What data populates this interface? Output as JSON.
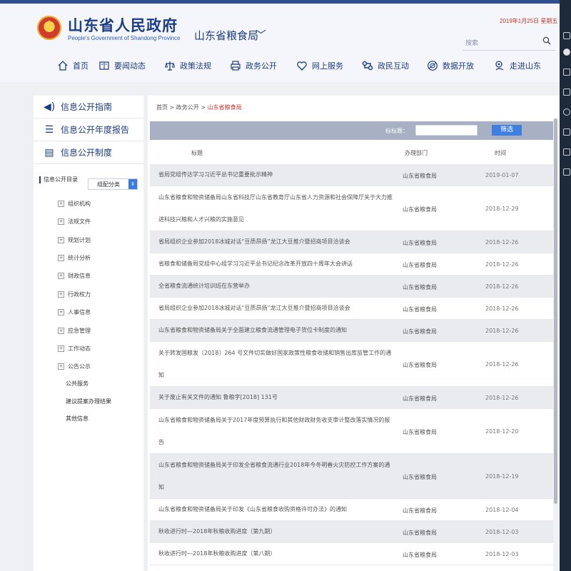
{
  "header": {
    "site_title": "山东省人民政府",
    "site_subtitle": "People's Government of Shandong Province",
    "dept_title": "山东省粮食局",
    "date_text": "2019年1月25日 星期五",
    "search_label": "搜索"
  },
  "nav": [
    {
      "label": "首页",
      "icon": "home-icon"
    },
    {
      "label": "要闻动态",
      "icon": "news-icon"
    },
    {
      "label": "政策法规",
      "icon": "scale-icon"
    },
    {
      "label": "政务公开",
      "icon": "printer-icon"
    },
    {
      "label": "网上服务",
      "icon": "heart-icon"
    },
    {
      "label": "政民互动",
      "icon": "link-icon"
    },
    {
      "label": "数据开放",
      "icon": "dataset-icon"
    },
    {
      "label": "走进山东",
      "icon": "location-icon"
    }
  ],
  "sidebar": {
    "guides": [
      {
        "label": "信息公开指南",
        "icon": "speaker-icon"
      },
      {
        "label": "信息公开年度报告",
        "icon": "list-icon"
      },
      {
        "label": "信息公开制度",
        "icon": "print-icon"
      }
    ],
    "catalog_title": "信息公开目录",
    "catalog_select": "组配分类",
    "tree": [
      "组织机构",
      "法规文件",
      "规划计划",
      "统计分析",
      "财政信息",
      "行政权力",
      "人事信息",
      "应急管理",
      "工作动态",
      "公告公示"
    ],
    "leaves": [
      "公共服务",
      "建议提案办理结果",
      "其他信息"
    ]
  },
  "main": {
    "breadcrumb_prefix": "首页 > 政务公开 > ",
    "breadcrumb_current": "山东省粮食局",
    "filter_label": "标标题：",
    "filter_button": "筛选",
    "columns": {
      "title": "标题",
      "dept": "办理部门",
      "time": "时间"
    },
    "rows": [
      {
        "title": "省局党组传达学习习近平总书记重要批示精神",
        "dept": "山东省粮食局",
        "time": "2019-01-07"
      },
      {
        "title": "山东省粮食和物资储备局山东省科技厅山东省教育厅山东省人力资源和社会保障厅关于大力推进科技兴粮和人才兴粮的实施意见",
        "dept": "山东省粮食局",
        "time": "2018-12-29"
      },
      {
        "title": "省局组织企业参加2018冰城对话“豆质昂扬”龙江大豆推介暨招商项目洽谈会",
        "dept": "山东省粮食局",
        "time": "2018-12-26"
      },
      {
        "title": "省粮食和储备局党组中心组学习习近平总书记纪念改革开放四十周年大会讲话",
        "dept": "山东省粮食局",
        "time": "2018-12-26"
      },
      {
        "title": "全省粮食流通统计培训班在东营举办",
        "dept": "山东省粮食局",
        "time": "2018-12-26"
      },
      {
        "title": "省局组织企业参加2018冰城对话“豆质昂扬”龙江大豆推介暨招商项目洽谈会",
        "dept": "山东省粮食局",
        "time": "2018-12-26"
      },
      {
        "title": "山东省粮食和物资储备局关于全面建立粮食流通管理电子货位卡制度的通知",
        "dept": "山东省粮食局",
        "time": "2018-12-26"
      },
      {
        "title": "关于转发国粮发〔2018〕264 号文件切实做好国家政策性粮食收储和销售出库监管工作的通知",
        "dept": "山东省粮食局",
        "time": "2018-12-26"
      },
      {
        "title": "关于废止有关文件的通知 鲁粮字[2018] 131号",
        "dept": "山东省粮食局",
        "time": "2018-12-26"
      },
      {
        "title": "山东省粮食和物资储备局关于2017年度预算执行和其他财政财务收支审计整改落实情况的报告",
        "dept": "山东省粮食局",
        "time": "2018-12-20"
      },
      {
        "title": "山东省粮食和物资储备局关于印发全省粮食流通行业2018年今冬明春火灾防控工作方案的通知",
        "dept": "山东省粮食局",
        "time": "2018-12-19"
      },
      {
        "title": "山东省粮食和物资储备局关于印发《山东省粮食收购资格许可办法》的通知",
        "dept": "山东省粮食局",
        "time": "2018-12-04"
      },
      {
        "title": "秋收进行时—2018年秋粮收购进度（第九期）",
        "dept": "山东省粮食局",
        "time": "2018-12-03"
      },
      {
        "title": "秋收进行时—2018年秋粮收购进度（第八期）",
        "dept": "山东省粮食局",
        "time": "2018-12-03"
      }
    ]
  },
  "colors": {
    "brand": "#1c3d86",
    "accent": "#d0302b",
    "filter_bar": "#a7b1c3",
    "button": "#3f7fe0"
  }
}
